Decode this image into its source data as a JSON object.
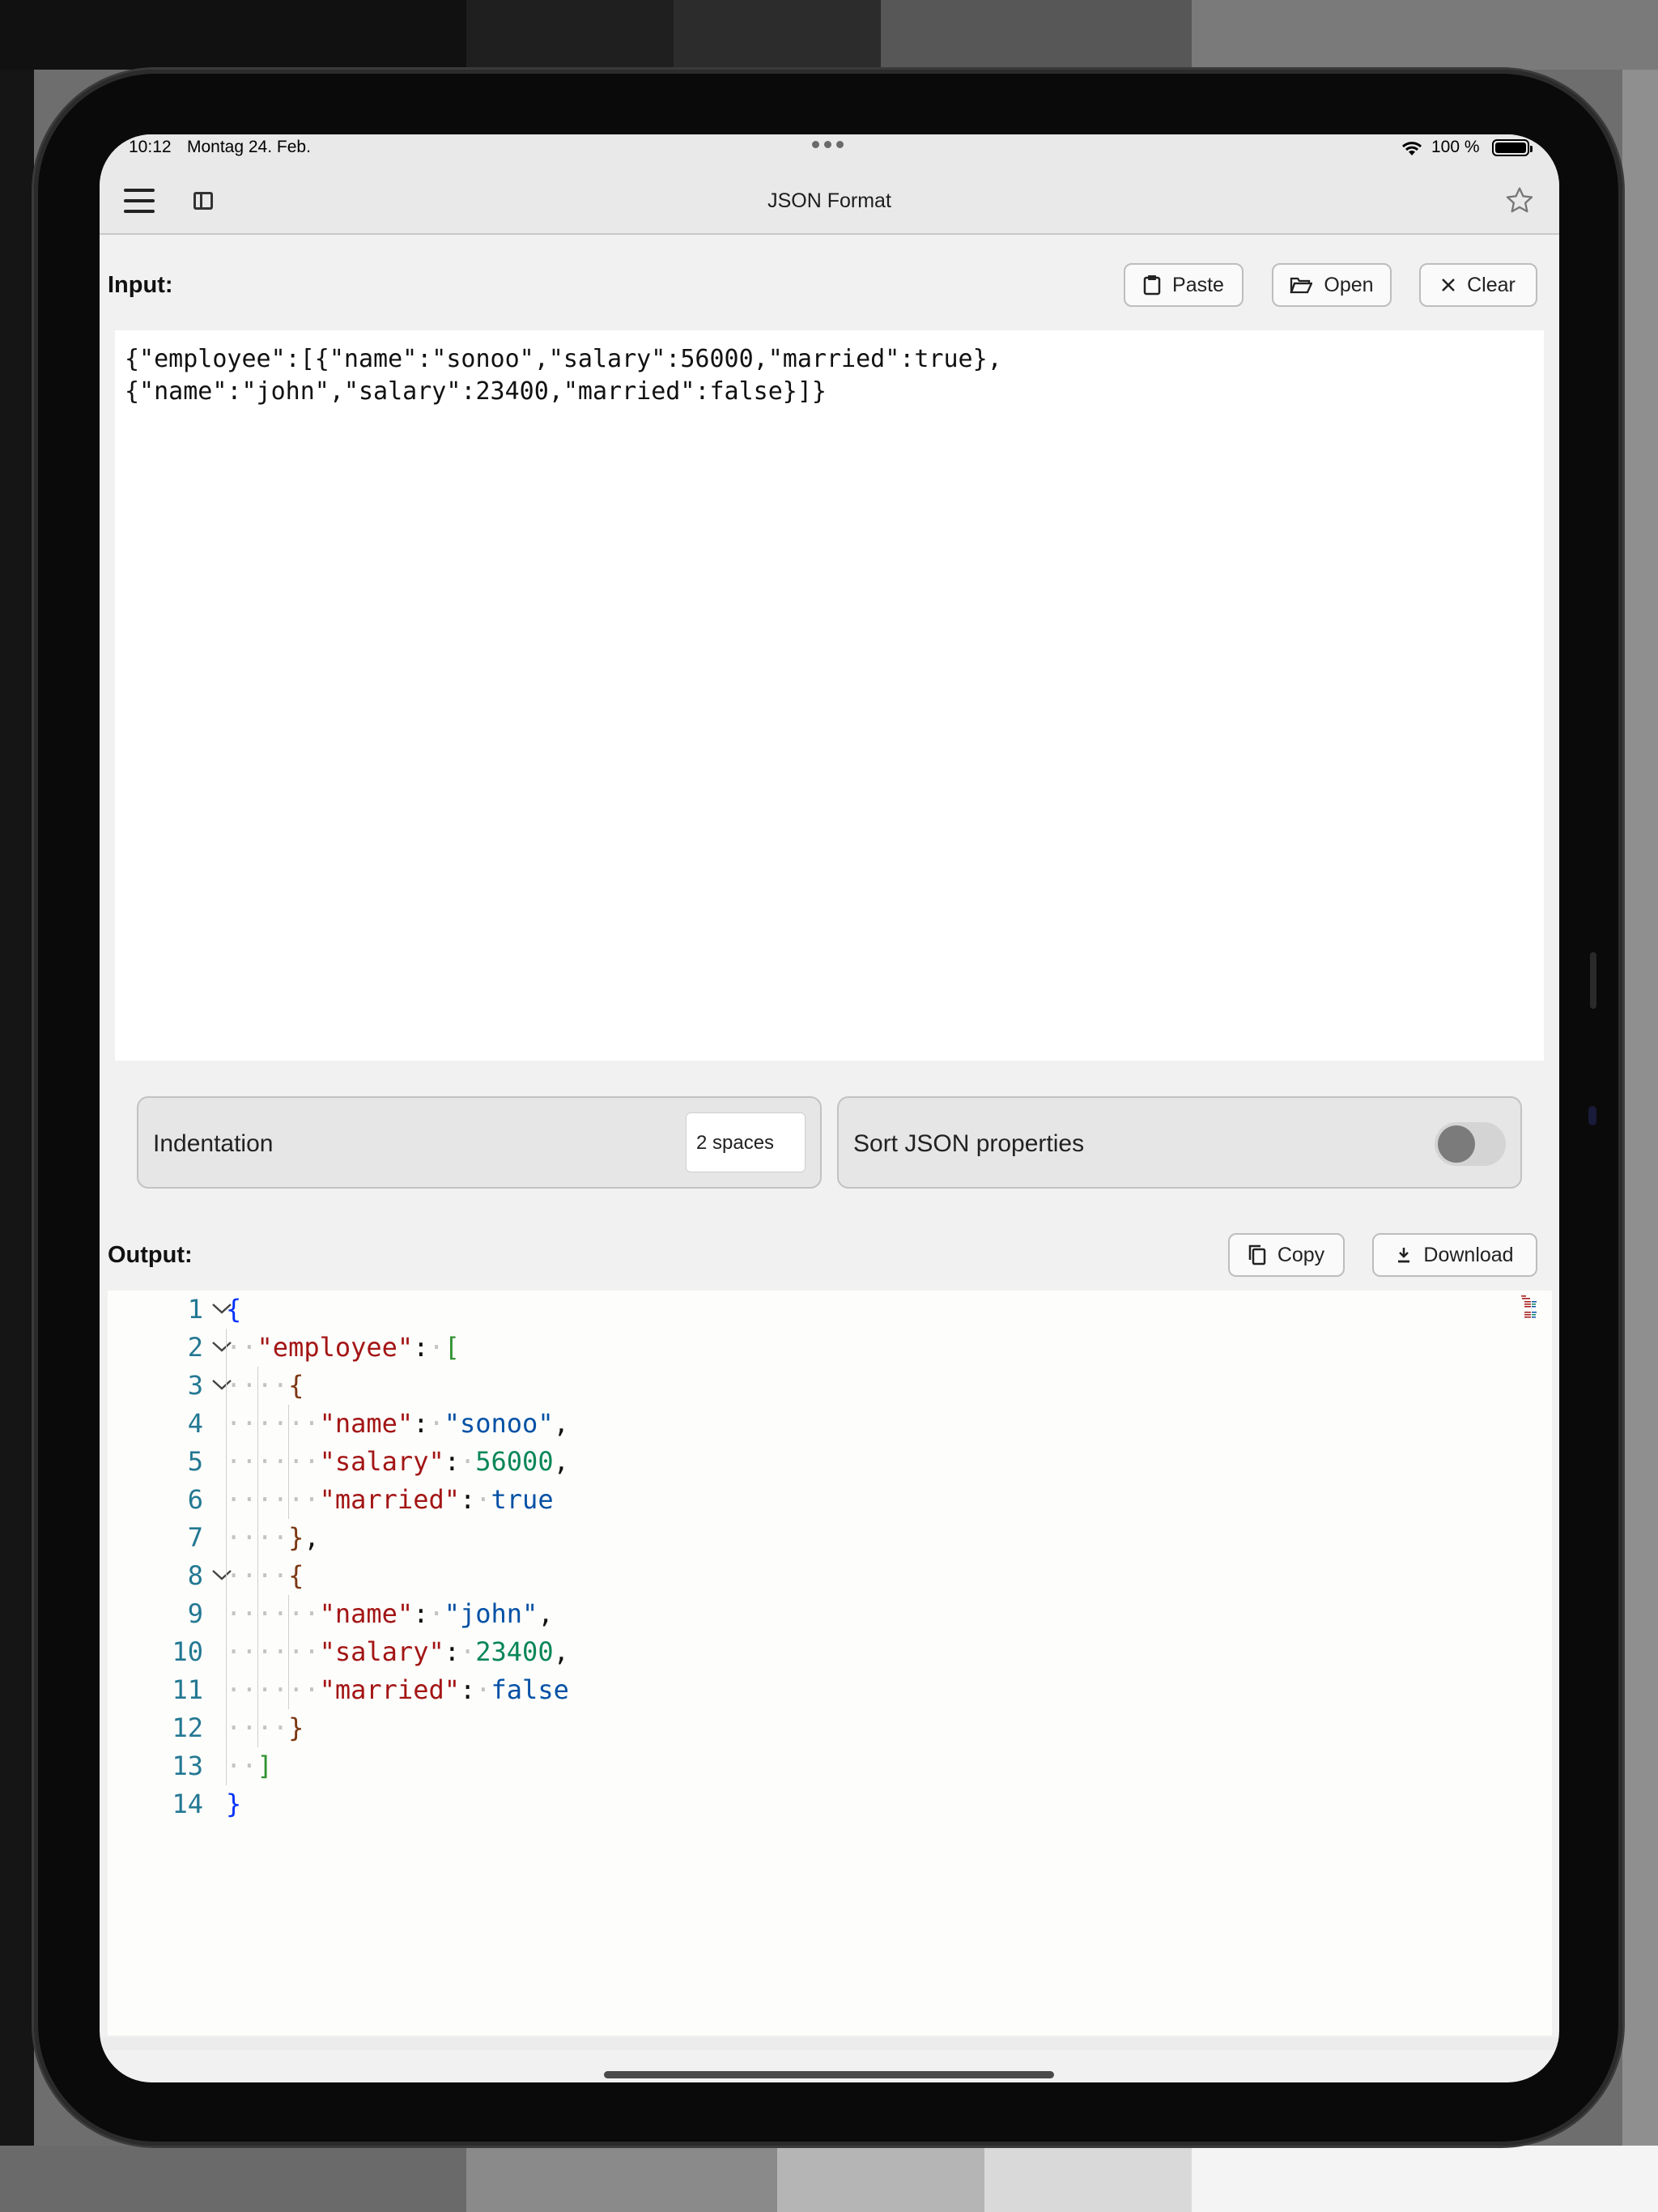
{
  "status_bar": {
    "time": "10:12",
    "date": "Montag 24. Feb.",
    "battery": "100 %"
  },
  "nav": {
    "title": "JSON Format",
    "icons": [
      "menu-icon",
      "sidebar-icon",
      "star-icon"
    ]
  },
  "input": {
    "label": "Input:",
    "paste_label": "Paste",
    "open_label": "Open",
    "clear_label": "Clear",
    "text": "{\"employee\":[{\"name\":\"sonoo\",\"salary\":56000,\"married\":true},\n{\"name\":\"john\",\"salary\":23400,\"married\":false}]}"
  },
  "options": {
    "indentation_label": "Indentation",
    "indentation_value": "2 spaces",
    "sort_label": "Sort JSON properties",
    "sort_enabled": false
  },
  "output": {
    "label": "Output:",
    "copy_label": "Copy",
    "download_label": "Download",
    "line_numbers": [
      "1",
      "2",
      "3",
      "4",
      "5",
      "6",
      "7",
      "8",
      "9",
      "10",
      "11",
      "12",
      "13",
      "14"
    ]
  },
  "colors": {
    "accent_key": "#a31515",
    "string": "#0451a5",
    "number": "#098658",
    "line_number": "#237893"
  }
}
